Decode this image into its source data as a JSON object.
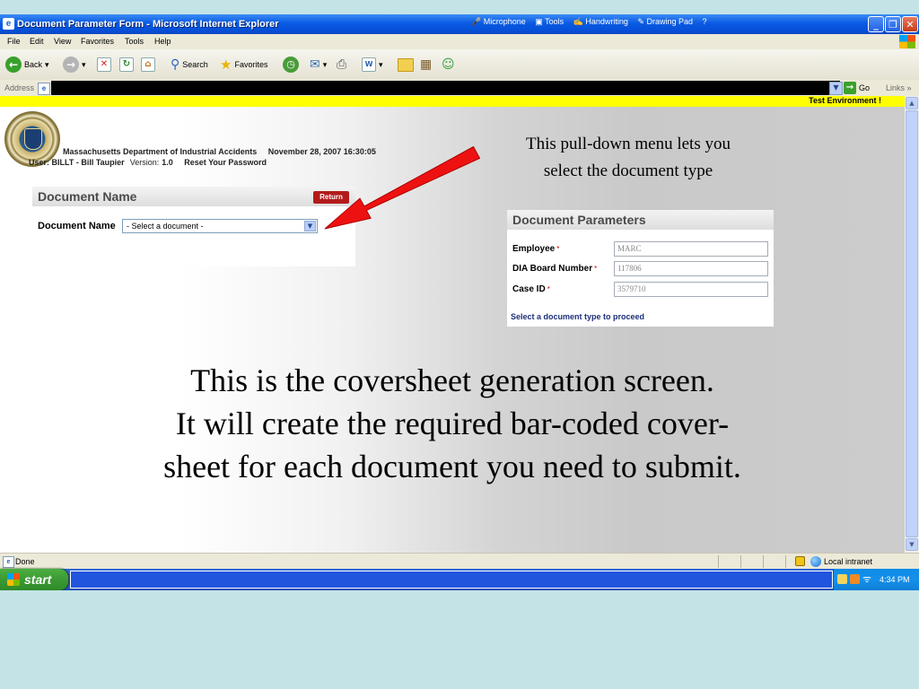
{
  "window": {
    "title": "Document Parameter Form - Microsoft Internet Explorer",
    "language_bar": [
      "Microphone",
      "Tools",
      "Handwriting",
      "Drawing Pad"
    ]
  },
  "menu": [
    "File",
    "Edit",
    "View",
    "Favorites",
    "Tools",
    "Help"
  ],
  "toolbar": {
    "back": "Back",
    "search": "Search",
    "favorites": "Favorites"
  },
  "address": {
    "label": "Address",
    "go": "Go",
    "links": "Links"
  },
  "page": {
    "banner": "Test Environment !",
    "agency": "Massachusetts Department of Industrial Accidents",
    "datetime": "November 28, 2007 16:30:05",
    "user": "User: BILLT - Bill Taupier",
    "version_label": "Version:",
    "version": "1.0",
    "reset_password": "Reset Your Password",
    "document_name_panel": {
      "title": "Document Name",
      "return_label": "Return",
      "field_label": "Document Name",
      "select_value": "- Select a document -"
    },
    "parameters_panel": {
      "title": "Document Parameters",
      "fields": [
        {
          "label": "Employee",
          "value": "MARC"
        },
        {
          "label": "DIA Board Number",
          "value": "117806"
        },
        {
          "label": "Case ID",
          "value": "3579710"
        }
      ],
      "required_marker": "*",
      "proceed_text": "Select a document type to proceed"
    }
  },
  "annotations": {
    "callout": [
      "This pull-down menu lets you",
      "select the document type"
    ],
    "body": [
      "This is the coversheet generation screen.",
      "It will create the required bar-coded cover-",
      "sheet for each document you need to submit."
    ]
  },
  "status": {
    "text": "Done",
    "zone": "Local intranet"
  },
  "taskbar": {
    "start": "start",
    "time": "4:34 PM"
  },
  "colors": {
    "arrow": "#ee1111",
    "banner": "#ffff00",
    "return_button": "#b31b1b",
    "proceed_text": "#1c2e7a",
    "background": "#c3e3e7"
  }
}
